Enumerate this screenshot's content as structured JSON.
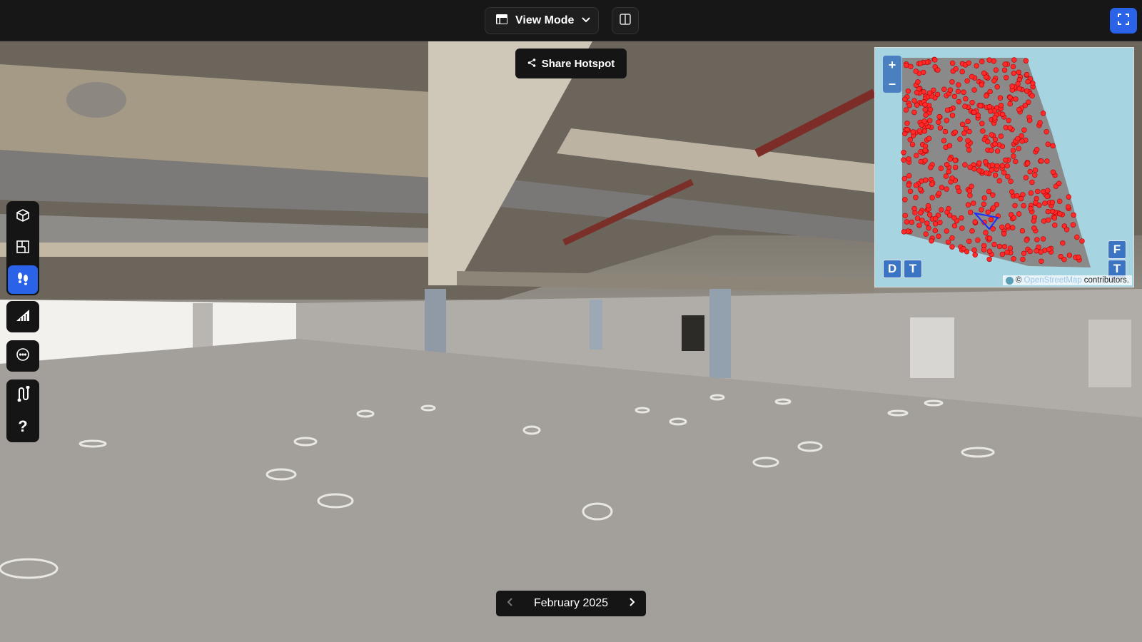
{
  "toolbar": {
    "view_mode_label": "View Mode",
    "view_mode_icon": "layout-icon",
    "split_icon": "split-view-icon",
    "fullscreen_icon": "fullscreen-icon"
  },
  "share": {
    "label": "Share Hotspot",
    "icon": "share-icon"
  },
  "left_tools": [
    {
      "name": "3d-model-icon",
      "active": false
    },
    {
      "name": "floorplan-icon",
      "active": false
    },
    {
      "name": "footsteps-icon",
      "active": true
    },
    {
      "name": "measure-icon",
      "active": false
    },
    {
      "name": "comment-icon",
      "active": false
    },
    {
      "name": "path-icon",
      "active": false
    },
    {
      "name": "help-icon",
      "active": false
    }
  ],
  "minimap": {
    "zoom_in": "+",
    "zoom_out": "–",
    "btn_d": "D",
    "btn_t_left": "T",
    "btn_f": "F",
    "btn_t_right": "T",
    "attribution_prefix": "©",
    "attribution_link": "OpenStreetMap",
    "attribution_suffix": "contributors."
  },
  "date_nav": {
    "label": "February 2025"
  },
  "colors": {
    "accent": "#2a62e8",
    "hotspot_dot": "#ff2a2a",
    "map_water": "#a6d4e1"
  }
}
